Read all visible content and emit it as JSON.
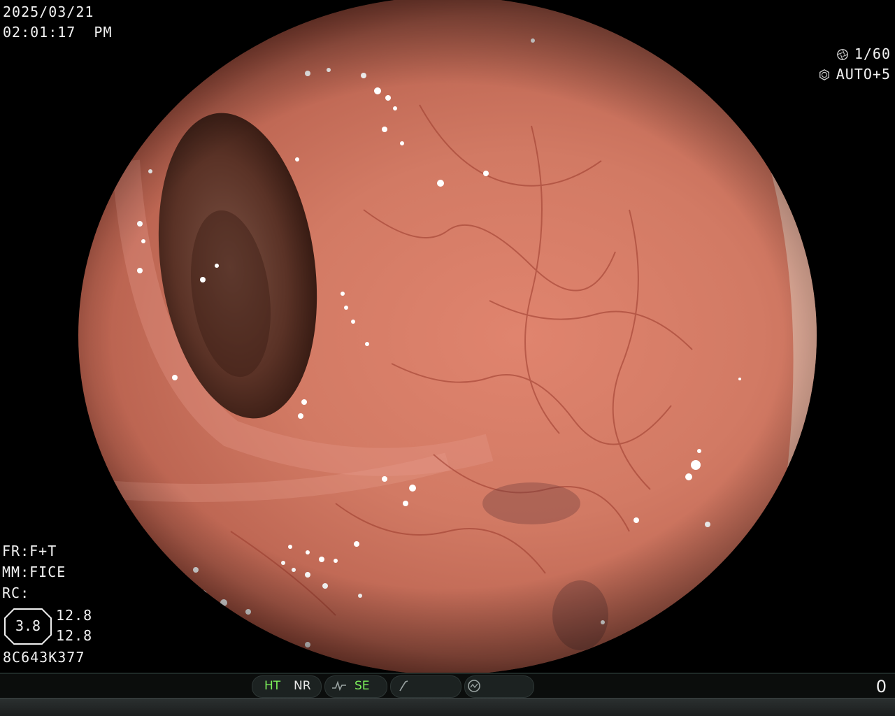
{
  "header": {
    "date": "2025/03/21",
    "time": "02:01:17  PM",
    "shutter": "1/60",
    "iris": "AUTO+5",
    "shutter_icon": "aperture-icon",
    "iris_icon": "iris-icon"
  },
  "settings": {
    "fr": "FR:F+T",
    "mm": "MM:FICE",
    "rc": "RC:",
    "zoom": "3.8",
    "value_1": "12.8",
    "value_2": "12.8",
    "serial": "8C643K377"
  },
  "status_bar": {
    "ht": "HT",
    "nr": "NR",
    "se": "SE",
    "se_icon": "waveform-icon",
    "pen_icon": "pen-icon",
    "gauge_icon": "gauge-icon",
    "counter": "0"
  },
  "colors": {
    "green_indicator": "#7cf05a",
    "tissue": "#c9705c",
    "background": "#000000"
  }
}
